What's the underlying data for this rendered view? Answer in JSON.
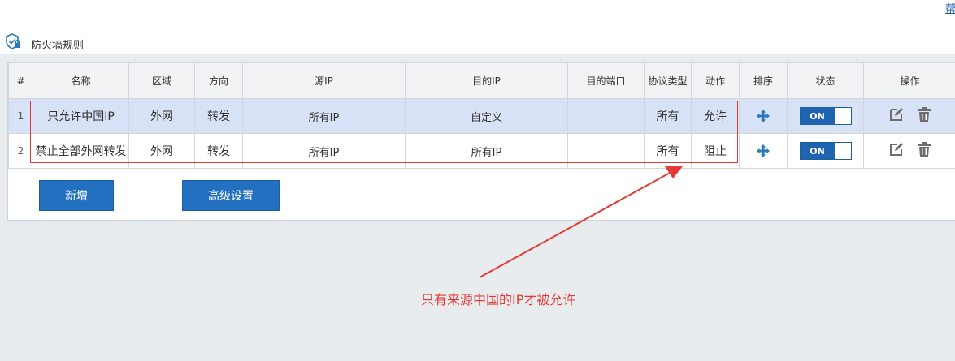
{
  "header": {
    "help_label": "帮助",
    "title": "防火墙规则"
  },
  "table": {
    "columns": [
      "#",
      "名称",
      "区域",
      "方向",
      "源IP",
      "目的IP",
      "目的端口",
      "协议类型",
      "动作",
      "排序",
      "状态",
      "操作"
    ],
    "rows": [
      {
        "index": "1",
        "name": "只允许中国IP",
        "zone": "外网",
        "direction": "转发",
        "src_ip": "所有IP",
        "dst_ip": "自定义",
        "dst_port": "",
        "protocol": "所有",
        "action": "允许",
        "status": "ON"
      },
      {
        "index": "2",
        "name": "禁止全部外网转发",
        "zone": "外网",
        "direction": "转发",
        "src_ip": "所有IP",
        "dst_ip": "所有IP",
        "dst_port": "",
        "protocol": "所有",
        "action": "阻止",
        "status": "ON"
      }
    ]
  },
  "buttons": {
    "add_label": "新增",
    "advanced_label": "高级设置"
  },
  "annotation": {
    "text": "只有来源中国的IP才被允许",
    "color": "#e53935"
  },
  "icons": {
    "title": "shield-icon",
    "sort": "move-arrows-icon",
    "edit": "edit-icon",
    "delete": "trash-icon"
  },
  "colors": {
    "accent": "#236fc0",
    "selected_row": "#d7e2f6",
    "annotation": "#e53935"
  }
}
